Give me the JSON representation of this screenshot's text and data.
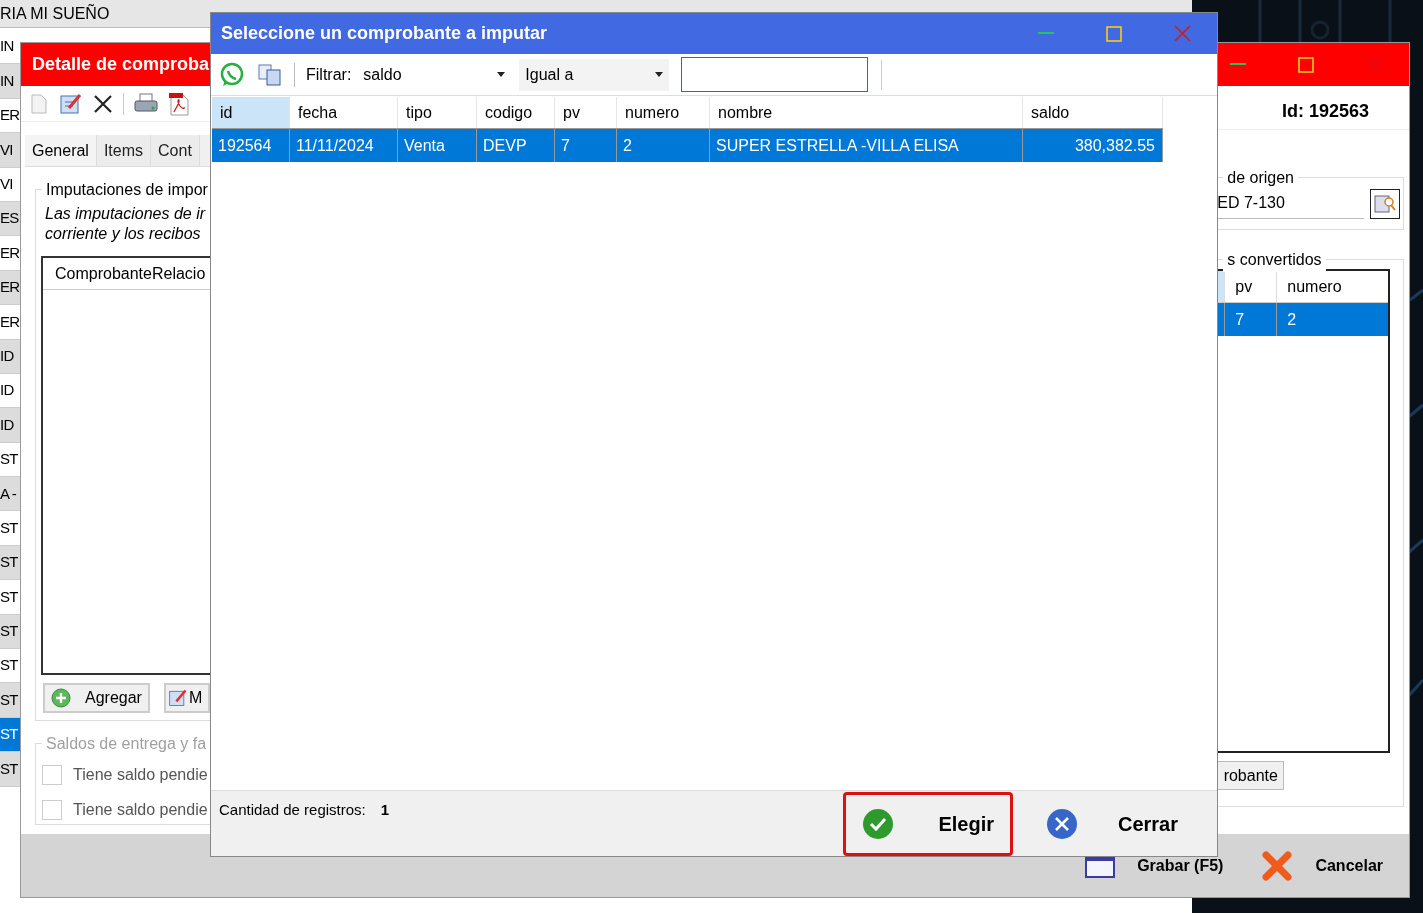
{
  "background_grid": {
    "top_cell": "RIA MI SUEÑO",
    "rows": [
      {
        "text": "IN",
        "selected": false
      },
      {
        "text": "IN",
        "selected": false
      },
      {
        "text": "ER",
        "selected": false
      },
      {
        "text": "VI",
        "selected": false
      },
      {
        "text": "VI",
        "selected": false
      },
      {
        "text": "ES",
        "selected": false
      },
      {
        "text": "ER",
        "selected": false
      },
      {
        "text": "ER",
        "selected": false
      },
      {
        "text": "ER",
        "selected": false
      },
      {
        "text": "ID",
        "selected": false
      },
      {
        "text": "ID",
        "selected": false
      },
      {
        "text": "ID",
        "selected": false
      },
      {
        "text": "ST",
        "selected": false
      },
      {
        "text": "A -",
        "selected": false
      },
      {
        "text": "ST",
        "selected": false
      },
      {
        "text": "ST",
        "selected": false
      },
      {
        "text": "ST",
        "selected": false
      },
      {
        "text": "ST",
        "selected": false
      },
      {
        "text": "ST",
        "selected": false
      },
      {
        "text": "ST",
        "selected": false
      },
      {
        "text": "ST",
        "selected": true
      },
      {
        "text": "ST",
        "selected": false
      }
    ]
  },
  "detail_window": {
    "title": "Detalle de comproba",
    "tabs": [
      {
        "label": "General",
        "selected": true
      },
      {
        "label": "Items",
        "selected": false
      },
      {
        "label": "Cont",
        "selected": false
      }
    ],
    "imputaciones": {
      "legend": "Imputaciones de impor",
      "note": "Las imputaciones de ir\ncorriente y los recibos",
      "column": "ComprobanteRelacio",
      "buttons": [
        {
          "label": "Agregar",
          "kind": "add"
        },
        {
          "label": "M",
          "kind": "edit"
        }
      ]
    },
    "saldos": {
      "legend": "Saldos de entrega y fa",
      "disabled": true,
      "checkboxes": [
        {
          "label": "Tiene saldo pendie",
          "checked": false
        },
        {
          "label": "Tiene saldo pendie",
          "checked": false
        }
      ]
    },
    "id_label": "Id: 192563",
    "origen": {
      "legend": "de origen",
      "value": "ED 7-130"
    },
    "convertidos": {
      "legend": "s convertidos",
      "columns": [
        "pv",
        "numero"
      ],
      "rows": [
        {
          "cells": [
            "7",
            "2"
          ],
          "selected": true
        }
      ],
      "button": "robante"
    },
    "footer_buttons": [
      {
        "label": "Grabar (F5)",
        "kind": "save"
      },
      {
        "label": "Cancelar",
        "kind": "cancel"
      }
    ]
  },
  "dialog": {
    "title": "Seleccione un comprobante a imputar",
    "filter_label": "Filtrar:",
    "filter_field": "saldo",
    "operator": "Igual a",
    "columns": [
      {
        "label": "id",
        "sorted": true
      },
      {
        "label": "fecha",
        "sorted": false
      },
      {
        "label": "tipo",
        "sorted": false
      },
      {
        "label": "codigo",
        "sorted": false
      },
      {
        "label": "pv",
        "sorted": false
      },
      {
        "label": "numero",
        "sorted": false
      },
      {
        "label": "nombre",
        "sorted": false
      },
      {
        "label": "saldo",
        "sorted": false
      }
    ],
    "rows": [
      {
        "cells": [
          "192564",
          "11/11/2024",
          "Venta",
          "DEVP",
          "7",
          "2",
          "SUPER ESTRELLA -VILLA ELISA",
          "380,382.55"
        ],
        "selected": true
      }
    ],
    "count_label": "Cantidad de registros:",
    "count": "1",
    "buttons": [
      {
        "label": "Elegir",
        "kind": "choose",
        "highlighted": true
      },
      {
        "label": "Cerrar",
        "kind": "close",
        "highlighted": false
      }
    ]
  }
}
